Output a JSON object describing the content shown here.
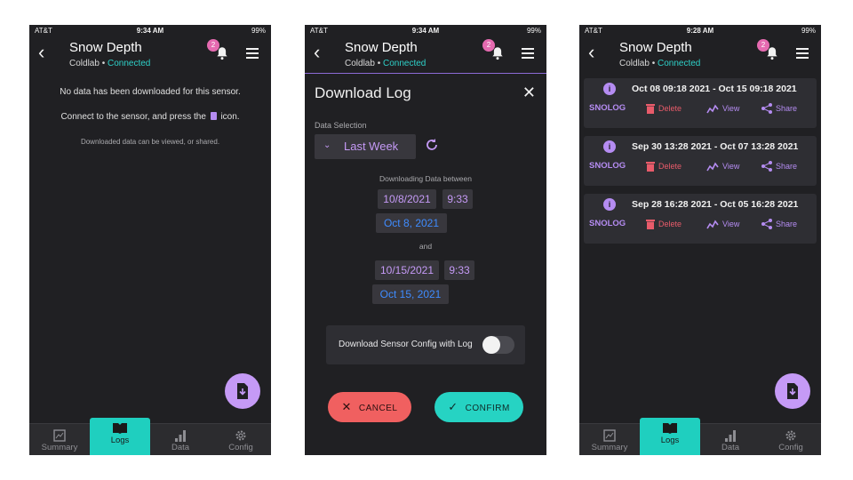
{
  "colors": {
    "accent_purple": "#c59af6",
    "teal": "#1fcfbf",
    "danger": "#f06060",
    "link_blue": "#3f8cff",
    "bg": "#202023"
  },
  "screens": [
    {
      "status": {
        "carrier": "AT&T",
        "time": "9:34 AM",
        "battery": "99%"
      },
      "app": {
        "title": "Snow Depth",
        "device": "Coldlab",
        "connection": "Connected",
        "notif_count": "2"
      },
      "empty": {
        "line1": "No data has been downloaded for this sensor.",
        "line2_pre": "Connect to the sensor, and press the",
        "line2_post": "icon.",
        "line3": "Downloaded data can be viewed, or shared."
      }
    },
    {
      "status": {
        "carrier": "AT&T",
        "time": "9:34 AM",
        "battery": "99%"
      },
      "app": {
        "title": "Snow Depth",
        "device": "Coldlab",
        "connection": "Connected",
        "notif_count": "2"
      },
      "dialog": {
        "title": "Download Log",
        "selection_label": "Data Selection",
        "selection_value": "Last Week",
        "between_label": "Downloading Data between",
        "start_date": "10/8/2021",
        "start_time": "9:33",
        "start_pretty": "Oct 8, 2021",
        "and_label": "and",
        "end_date": "10/15/2021",
        "end_time": "9:33",
        "end_pretty": "Oct 15, 2021",
        "toggle_label": "Download Sensor Config with Log",
        "toggle_on": false,
        "cancel": "CANCEL",
        "confirm": "CONFIRM"
      }
    },
    {
      "status": {
        "carrier": "AT&T",
        "time": "9:28 AM",
        "battery": "99%"
      },
      "app": {
        "title": "Snow Depth",
        "device": "Coldlab",
        "connection": "Connected",
        "notif_count": "2"
      },
      "logs": [
        {
          "range": "Oct 08 09:18 2021  -  Oct 15 09:18 2021",
          "tag": "SNOLOG",
          "delete": "Delete",
          "view": "View",
          "share": "Share"
        },
        {
          "range": "Sep 30 13:28 2021  -  Oct 07 13:28 2021",
          "tag": "SNOLOG",
          "delete": "Delete",
          "view": "View",
          "share": "Share"
        },
        {
          "range": "Sep 28 16:28 2021  -  Oct 05 16:28 2021",
          "tag": "SNOLOG",
          "delete": "Delete",
          "view": "View",
          "share": "Share"
        }
      ]
    }
  ],
  "nav": [
    "Summary",
    "Logs",
    "Data",
    "Config"
  ],
  "nav_active": "Logs",
  "icons": [
    "back-arrow-icon",
    "bell-icon",
    "menu-icon",
    "download-file-icon",
    "summary-icon",
    "logs-book-icon",
    "data-bars-icon",
    "config-gear-icon",
    "refresh-icon",
    "info-icon",
    "trash-icon",
    "chart-icon",
    "share-icon",
    "close-icon",
    "check-icon"
  ]
}
